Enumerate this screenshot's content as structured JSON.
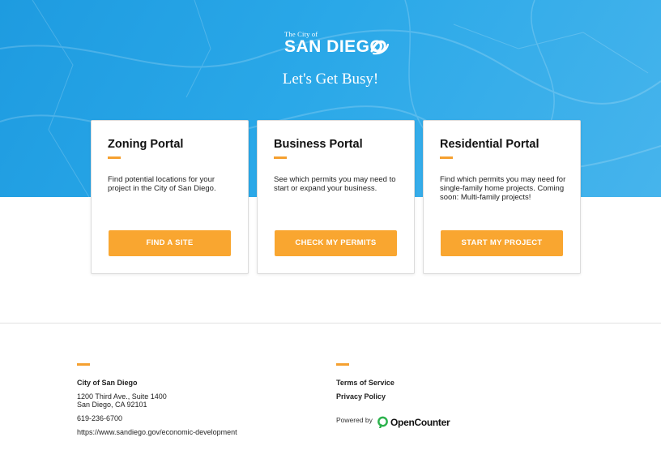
{
  "hero": {
    "logo_small": "The City of",
    "logo_big": "SAN DIEGO",
    "title": "Let's Get Busy!",
    "background_color": "#2aa8e8"
  },
  "cards": [
    {
      "title": "Zoning Portal",
      "description": "Find potential locations for your project in the City of San Diego.",
      "button": "FIND A SITE"
    },
    {
      "title": "Business Portal",
      "description": "See which permits you may need to start or expand your business.",
      "button": "CHECK MY PERMITS"
    },
    {
      "title": "Residential Portal",
      "description": "Find which permits you may need for single-family home projects. Coming soon: Multi-family projects!",
      "button": "START MY PROJECT"
    }
  ],
  "footer": {
    "org_name": "City of San Diego",
    "address_line1": "1200 Third Ave., Suite 1400",
    "address_line2": "San Diego, CA 92101",
    "phone": "619-236-6700",
    "website": "https://www.sandiego.gov/economic-development",
    "links": {
      "terms": "Terms of Service",
      "privacy": "Privacy Policy"
    },
    "powered_by": "Powered by",
    "brand": "OpenCounter"
  },
  "colors": {
    "accent": "#f9a630",
    "hero": "#2aa8e8",
    "opencounter_green": "#2bb24c"
  }
}
